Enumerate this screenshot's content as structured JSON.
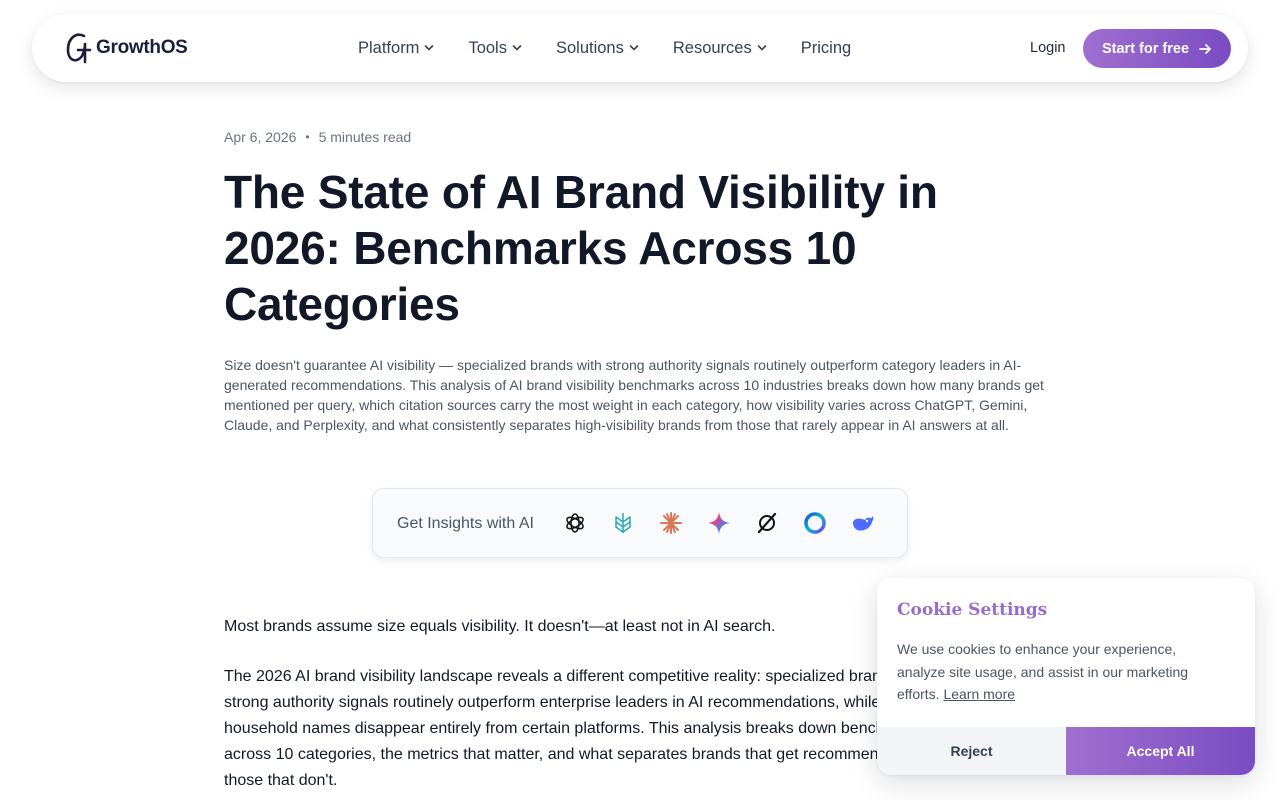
{
  "header": {
    "logo_text": "GrowthOS",
    "menu": [
      {
        "label": "Platform",
        "has_dropdown": true
      },
      {
        "label": "Tools",
        "has_dropdown": true
      },
      {
        "label": "Solutions",
        "has_dropdown": true
      },
      {
        "label": "Resources",
        "has_dropdown": true
      },
      {
        "label": "Pricing",
        "has_dropdown": false
      }
    ],
    "login_label": "Login",
    "cta_label": "Start for free",
    "cta_icon": "arrow-right-icon"
  },
  "article": {
    "date": "Apr 6, 2026",
    "separator": "•",
    "read_time": "5 minutes read",
    "title": "The State of AI Brand Visibility in 2026: Benchmarks Across 10 Categories",
    "summary": "Size doesn't guarantee AI visibility — specialized brands with strong authority signals routinely outperform category leaders in AI-generated recommendations. This analysis of AI brand visibility benchmarks across 10 industries breaks down how many brands get mentioned per query, which citation sources carry the most weight in each category, how visibility varies across ChatGPT, Gemini, Claude, and Perplexity, and what consistently separates high-visibility brands from those that rarely appear in AI answers at all.",
    "insights_label": "Get Insights with AI",
    "insights_icons": [
      "chatgpt-icon",
      "perplexity-icon",
      "claude-icon",
      "gemini-icon",
      "grok-icon",
      "copilot-icon",
      "deepseek-icon"
    ],
    "paragraph_1": "Most brands assume size equals visibility. It doesn't—at least not in AI search.",
    "paragraph_2": "The 2026 AI brand visibility landscape reveals a different competitive reality: specialized brands with strong authority signals routinely outperform enterprise leaders in AI recommendations, while some household names disappear entirely from certain platforms. This analysis breaks down benchmarks across 10 categories, the metrics that matter, and what separates brands that get recommended from those that don't."
  },
  "cookie": {
    "title": "Cookie Settings",
    "text": "We use cookies to enhance your experience, analyze site usage, and assist in our marketing efforts.",
    "learn_more": "Learn more",
    "reject_label": "Reject",
    "accept_label": "Accept All"
  },
  "colors": {
    "accent_start": "#a06fd0",
    "accent_end": "#7a4cc2",
    "cookie_title": "#9b6bc9",
    "logo_text": "#1b1f3b"
  }
}
